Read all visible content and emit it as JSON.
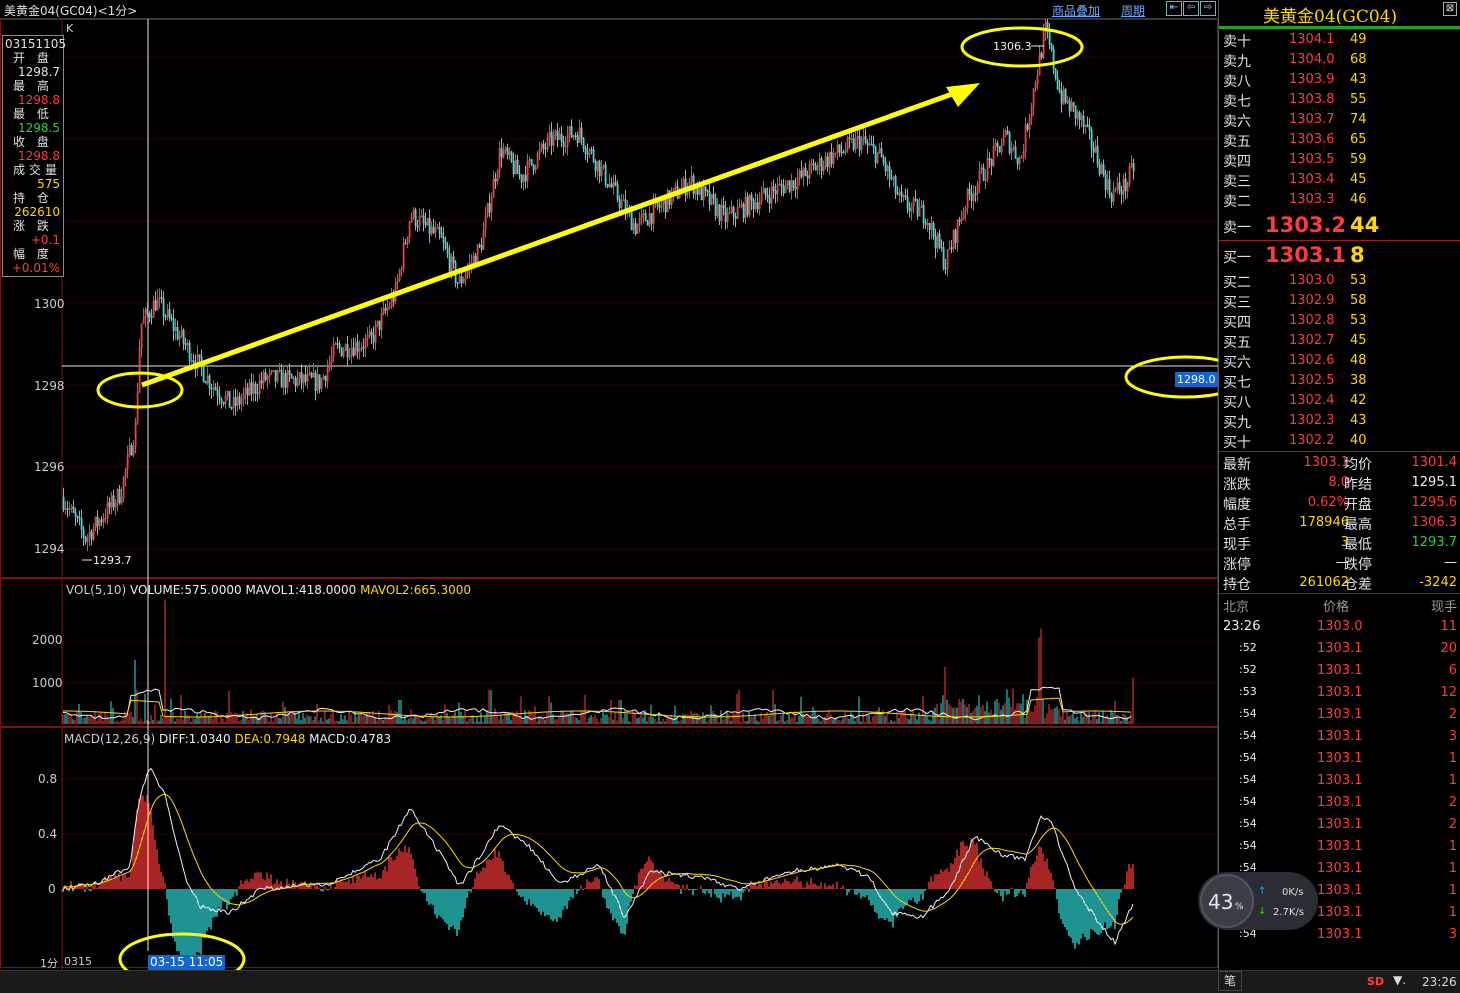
{
  "window": {
    "title": "美黄金04(GC04)<1分>",
    "links": [
      "商品叠加",
      "周期"
    ],
    "corner_k": "K"
  },
  "infobox": {
    "code": "03151105",
    "rows": [
      {
        "label": "开 盘",
        "value": "1298.7",
        "color": "#e0e0e0"
      },
      {
        "label": "最 高",
        "value": "1298.8",
        "color": "#ff3b3b"
      },
      {
        "label": "最 低",
        "value": "1298.5",
        "color": "#2bd22b"
      },
      {
        "label": "收 盘",
        "value": "1298.8",
        "color": "#ff3b3b"
      },
      {
        "label": "成交量",
        "value": "575",
        "color": "#ffd700"
      },
      {
        "label": "持 仓",
        "value": "262610",
        "color": "#ffd700"
      },
      {
        "label": "涨 跌",
        "value": "+0.1",
        "color": "#ff3b3b"
      },
      {
        "label": "幅 度",
        "value": "+0.01%",
        "color": "#ff3b3b"
      }
    ]
  },
  "price_chart": {
    "y_ticks": [
      "1300",
      "1298",
      "1296",
      "1294"
    ],
    "high_label": "1306.3",
    "low_label": "1293.7",
    "crosshair_price": "1298.0"
  },
  "volume_panel": {
    "header_prefix": "VOL(5,10)",
    "volume": "VOLUME:575.0000",
    "mavol1": "MAVOL1:418.0000",
    "mavol2": "MAVOL2:665.3000",
    "y_ticks": [
      "2000",
      "1000"
    ]
  },
  "macd_panel": {
    "header_prefix": "MACD(12,26,9)",
    "diff": "DIFF:1.0340",
    "dea": "DEA:0.7948",
    "macd": "MACD:0.4783",
    "y_ticks": [
      "0.8",
      "0.4",
      "0"
    ]
  },
  "x_axis": {
    "period": "1分",
    "start": "0315",
    "cursor_time": "03-15 11:05"
  },
  "quote_panel": {
    "title": "美黄金04(GC04)",
    "asks": [
      {
        "label": "卖十",
        "price": "1304.1",
        "vol": "49"
      },
      {
        "label": "卖九",
        "price": "1304.0",
        "vol": "68"
      },
      {
        "label": "卖八",
        "price": "1303.9",
        "vol": "43"
      },
      {
        "label": "卖七",
        "price": "1303.8",
        "vol": "55"
      },
      {
        "label": "卖六",
        "price": "1303.7",
        "vol": "74"
      },
      {
        "label": "卖五",
        "price": "1303.6",
        "vol": "65"
      },
      {
        "label": "卖四",
        "price": "1303.5",
        "vol": "59"
      },
      {
        "label": "卖三",
        "price": "1303.4",
        "vol": "45"
      },
      {
        "label": "卖二",
        "price": "1303.3",
        "vol": "46"
      }
    ],
    "ask1": {
      "label": "卖一",
      "price": "1303.2",
      "vol": "44"
    },
    "bid1": {
      "label": "买一",
      "price": "1303.1",
      "vol": "8"
    },
    "bids": [
      {
        "label": "买二",
        "price": "1303.0",
        "vol": "53"
      },
      {
        "label": "买三",
        "price": "1302.9",
        "vol": "58"
      },
      {
        "label": "买四",
        "price": "1302.8",
        "vol": "53"
      },
      {
        "label": "买五",
        "price": "1302.7",
        "vol": "45"
      },
      {
        "label": "买六",
        "price": "1302.6",
        "vol": "48"
      },
      {
        "label": "买七",
        "price": "1302.5",
        "vol": "38"
      },
      {
        "label": "买八",
        "price": "1302.4",
        "vol": "42"
      },
      {
        "label": "买九",
        "price": "1302.3",
        "vol": "43"
      },
      {
        "label": "买十",
        "price": "1302.2",
        "vol": "40"
      }
    ],
    "stats": [
      {
        "l1": "最新",
        "v1": "1303.1",
        "c1": "#ff3b3b",
        "l2": "均价",
        "v2": "1301.4",
        "c2": "#ff3b3b"
      },
      {
        "l1": "涨跌",
        "v1": "8.0",
        "c1": "#ff3b3b",
        "l2": "昨结",
        "v2": "1295.1",
        "c2": "#f0f0f0"
      },
      {
        "l1": "幅度",
        "v1": "0.62%",
        "c1": "#ff3b3b",
        "l2": "开盘",
        "v2": "1295.6",
        "c2": "#ff3b3b"
      },
      {
        "l1": "总手",
        "v1": "178946",
        "c1": "#ffd700",
        "l2": "最高",
        "v2": "1306.3",
        "c2": "#ff3b3b"
      },
      {
        "l1": "现手",
        "v1": "3",
        "c1": "#ffd700",
        "l2": "最低",
        "v2": "1293.7",
        "c2": "#2bd22b"
      },
      {
        "l1": "涨停",
        "v1": "—",
        "c1": "#f0f0f0",
        "l2": "跌停",
        "v2": "—",
        "c2": "#f0f0f0"
      },
      {
        "l1": "持仓",
        "v1": "261062",
        "c1": "#ffd700",
        "l2": "仓差",
        "v2": "-3242",
        "c2": "#ffd700"
      }
    ],
    "ticks_header": {
      "c1": "北京",
      "c2": "价格",
      "c3": "现手"
    },
    "ticks": [
      {
        "t": "23:26",
        "p": "1303.0",
        "v": "11"
      },
      {
        "t": ":52",
        "p": "1303.1",
        "v": "20"
      },
      {
        "t": ":52",
        "p": "1303.1",
        "v": "6"
      },
      {
        "t": ":53",
        "p": "1303.1",
        "v": "12"
      },
      {
        "t": ":54",
        "p": "1303.1",
        "v": "2"
      },
      {
        "t": ":54",
        "p": "1303.1",
        "v": "3"
      },
      {
        "t": ":54",
        "p": "1303.1",
        "v": "1"
      },
      {
        "t": ":54",
        "p": "1303.1",
        "v": "1"
      },
      {
        "t": ":54",
        "p": "1303.1",
        "v": "2"
      },
      {
        "t": ":54",
        "p": "1303.1",
        "v": "2"
      },
      {
        "t": ":54",
        "p": "1303.1",
        "v": "1"
      },
      {
        "t": ":54",
        "p": "1303.1",
        "v": "1"
      },
      {
        "t": ":54",
        "p": "1303.1",
        "v": "1"
      },
      {
        "t": ":54",
        "p": "1303.1",
        "v": "1"
      },
      {
        "t": ":54",
        "p": "1303.1",
        "v": "3"
      }
    ],
    "bottom_tab": "笔"
  },
  "network_widget": {
    "percent": "43",
    "percent_sign": "%",
    "up": "0K/s",
    "down": "2.7K/s"
  },
  "statusbar": {
    "sd": "SD",
    "time": "23:26"
  },
  "colors": {
    "up": "#ff3b3b",
    "down": "#2bd22b",
    "highlight": "#ffff00",
    "cyan": "#30e0e0",
    "grid": "#7a1414"
  }
}
